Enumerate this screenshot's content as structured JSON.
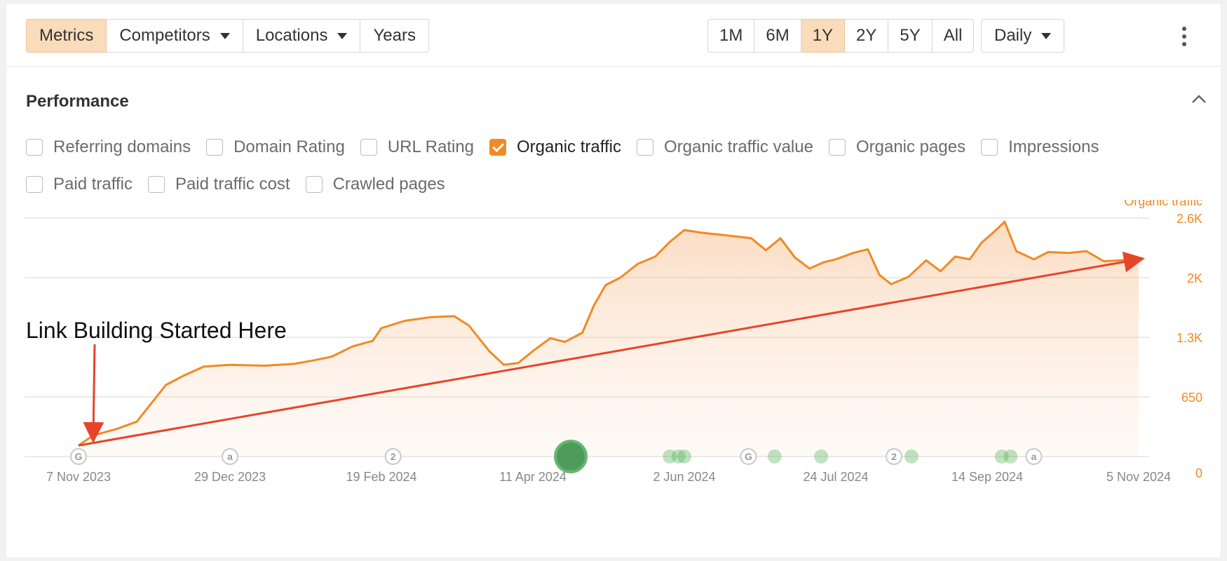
{
  "toolbar": {
    "view_tabs": [
      {
        "label": "Metrics",
        "active": true,
        "caret": false
      },
      {
        "label": "Competitors",
        "active": false,
        "caret": true
      },
      {
        "label": "Locations",
        "active": false,
        "caret": true
      },
      {
        "label": "Years",
        "active": false,
        "caret": false
      }
    ],
    "ranges": [
      {
        "label": "1M",
        "active": false
      },
      {
        "label": "6M",
        "active": false
      },
      {
        "label": "1Y",
        "active": true
      },
      {
        "label": "2Y",
        "active": false
      },
      {
        "label": "5Y",
        "active": false
      },
      {
        "label": "All",
        "active": false
      }
    ],
    "granularity": "Daily",
    "more_icon": "kebab-menu-icon"
  },
  "performance": {
    "title": "Performance",
    "collapse_icon": "chevron-up-icon",
    "metrics": [
      {
        "label": "Referring domains",
        "checked": false
      },
      {
        "label": "Domain Rating",
        "checked": false
      },
      {
        "label": "URL Rating",
        "checked": false
      },
      {
        "label": "Organic traffic",
        "checked": true
      },
      {
        "label": "Organic traffic value",
        "checked": false
      },
      {
        "label": "Organic pages",
        "checked": false
      },
      {
        "label": "Impressions",
        "checked": false
      },
      {
        "label": "Paid traffic",
        "checked": false
      },
      {
        "label": "Paid traffic cost",
        "checked": false
      },
      {
        "label": "Crawled pages",
        "checked": false
      }
    ]
  },
  "colors": {
    "accent": "#f08a24",
    "trend": "#e8442a",
    "active_bg": "#fadcbb",
    "event_green": "#4caf50"
  },
  "annotation": "Link Building Started Here",
  "chart_data": {
    "type": "area",
    "series_label": "Organic traffic",
    "y_ticks": [
      "0",
      "650",
      "1.3K",
      "2K",
      "2.6K"
    ],
    "ylim": [
      0,
      2600
    ],
    "x_tick_labels": [
      "7 Nov 2023",
      "29 Dec 2023",
      "19 Feb 2024",
      "11 Apr 2024",
      "2 Jun 2024",
      "24 Jul 2024",
      "14 Sep 2024",
      "5 Nov 2024"
    ],
    "points": [
      [
        "2023-11-07",
        120
      ],
      [
        "2023-11-12",
        230
      ],
      [
        "2023-11-20",
        300
      ],
      [
        "2023-11-27",
        380
      ],
      [
        "2023-12-02",
        580
      ],
      [
        "2023-12-07",
        780
      ],
      [
        "2023-12-13",
        880
      ],
      [
        "2023-12-20",
        980
      ],
      [
        "2023-12-29",
        1000
      ],
      [
        "2024-01-10",
        990
      ],
      [
        "2024-01-20",
        1010
      ],
      [
        "2024-01-27",
        1050
      ],
      [
        "2024-02-02",
        1090
      ],
      [
        "2024-02-09",
        1200
      ],
      [
        "2024-02-16",
        1260
      ],
      [
        "2024-02-19",
        1400
      ],
      [
        "2024-02-27",
        1480
      ],
      [
        "2024-03-07",
        1520
      ],
      [
        "2024-03-15",
        1530
      ],
      [
        "2024-03-20",
        1430
      ],
      [
        "2024-03-27",
        1150
      ],
      [
        "2024-04-01",
        1000
      ],
      [
        "2024-04-06",
        1020
      ],
      [
        "2024-04-11",
        1150
      ],
      [
        "2024-04-17",
        1290
      ],
      [
        "2024-04-22",
        1250
      ],
      [
        "2024-04-28",
        1350
      ],
      [
        "2024-05-02",
        1650
      ],
      [
        "2024-05-06",
        1870
      ],
      [
        "2024-05-11",
        1950
      ],
      [
        "2024-05-17",
        2100
      ],
      [
        "2024-05-23",
        2180
      ],
      [
        "2024-05-28",
        2340
      ],
      [
        "2024-06-02",
        2470
      ],
      [
        "2024-06-08",
        2440
      ],
      [
        "2024-06-14",
        2420
      ],
      [
        "2024-06-20",
        2400
      ],
      [
        "2024-06-25",
        2380
      ],
      [
        "2024-06-30",
        2250
      ],
      [
        "2024-07-05",
        2380
      ],
      [
        "2024-07-10",
        2170
      ],
      [
        "2024-07-15",
        2050
      ],
      [
        "2024-07-20",
        2120
      ],
      [
        "2024-07-24",
        2150
      ],
      [
        "2024-07-30",
        2220
      ],
      [
        "2024-08-04",
        2260
      ],
      [
        "2024-08-08",
        1980
      ],
      [
        "2024-08-12",
        1880
      ],
      [
        "2024-08-18",
        1960
      ],
      [
        "2024-08-24",
        2140
      ],
      [
        "2024-08-29",
        2020
      ],
      [
        "2024-09-03",
        2180
      ],
      [
        "2024-09-08",
        2150
      ],
      [
        "2024-09-12",
        2330
      ],
      [
        "2024-09-16",
        2440
      ],
      [
        "2024-09-20",
        2560
      ],
      [
        "2024-09-24",
        2240
      ],
      [
        "2024-09-30",
        2150
      ],
      [
        "2024-10-05",
        2230
      ],
      [
        "2024-10-12",
        2220
      ],
      [
        "2024-10-18",
        2240
      ],
      [
        "2024-10-24",
        2130
      ],
      [
        "2024-10-30",
        2140
      ],
      [
        "2024-11-05",
        2170
      ]
    ],
    "trend_line": {
      "start": [
        "2023-11-07",
        120
      ],
      "end": [
        "2024-11-05",
        2150
      ]
    },
    "events": [
      {
        "date": "2023-11-07",
        "label": "G"
      },
      {
        "date": "2023-12-29",
        "label": "a"
      },
      {
        "date": "2024-02-23",
        "label": "2"
      },
      {
        "date": "2024-04-24",
        "label": "",
        "size": "large"
      },
      {
        "date": "2024-05-28",
        "label": ""
      },
      {
        "date": "2024-05-31",
        "label": ""
      },
      {
        "date": "2024-06-02",
        "label": ""
      },
      {
        "date": "2024-06-24",
        "label": "G"
      },
      {
        "date": "2024-07-03",
        "label": ""
      },
      {
        "date": "2024-07-19",
        "label": ""
      },
      {
        "date": "2024-08-13",
        "label": "2"
      },
      {
        "date": "2024-08-19",
        "label": ""
      },
      {
        "date": "2024-09-19",
        "label": ""
      },
      {
        "date": "2024-09-22",
        "label": ""
      },
      {
        "date": "2024-09-30",
        "label": "a"
      }
    ]
  }
}
